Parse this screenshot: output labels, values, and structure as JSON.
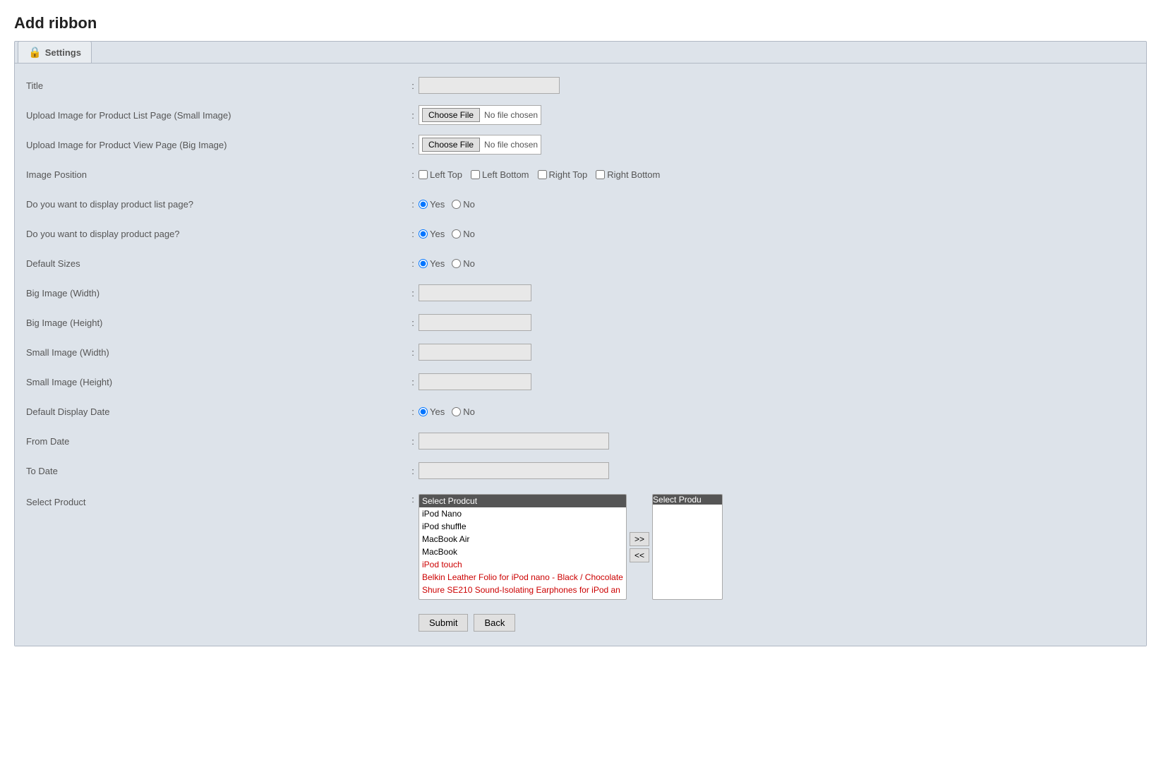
{
  "page": {
    "title": "Add ribbon"
  },
  "tab": {
    "label": "Settings",
    "icon": "🔒"
  },
  "form": {
    "fields": {
      "title_label": "Title",
      "upload_small_label": "Upload Image for Product List Page (Small Image)",
      "upload_big_label": "Upload Image for Product View Page (Big Image)",
      "image_position_label": "Image Position",
      "display_list_label": "Do you want to display product list page?",
      "display_page_label": "Do you want to display product page?",
      "default_sizes_label": "Default Sizes",
      "big_width_label": "Big Image (Width)",
      "big_height_label": "Big Image (Height)",
      "small_width_label": "Small Image (Width)",
      "small_height_label": "Small Image (Height)",
      "default_display_date_label": "Default Display Date",
      "from_date_label": "From Date",
      "to_date_label": "To Date",
      "select_product_label": "Select Product"
    },
    "file_no_chosen": "No file chosen",
    "choose_file": "Choose File",
    "image_positions": [
      "Left Top",
      "Left Bottom",
      "Right Top",
      "Right Bottom"
    ],
    "yes_label": "Yes",
    "no_label": "No",
    "products": [
      {
        "label": "Select Prodcut",
        "value": "",
        "header": true
      },
      {
        "label": "iPod Nano",
        "value": "ipod_nano"
      },
      {
        "label": "iPod shuffle",
        "value": "ipod_shuffle"
      },
      {
        "label": "MacBook Air",
        "value": "macbook_air"
      },
      {
        "label": "MacBook",
        "value": "macbook"
      },
      {
        "label": "iPod touch",
        "value": "ipod_touch",
        "red": true
      },
      {
        "label": "Belkin Leather Folio for iPod nano - Black / Chocolate",
        "value": "belkin",
        "red": true
      },
      {
        "label": "Shure SE210 Sound-Isolating Earphones for iPod an",
        "value": "shure",
        "red": true
      }
    ],
    "selected_products_header": "Select Produ",
    "move_right": ">>",
    "move_left": "<<",
    "submit_label": "Submit",
    "back_label": "Back"
  }
}
